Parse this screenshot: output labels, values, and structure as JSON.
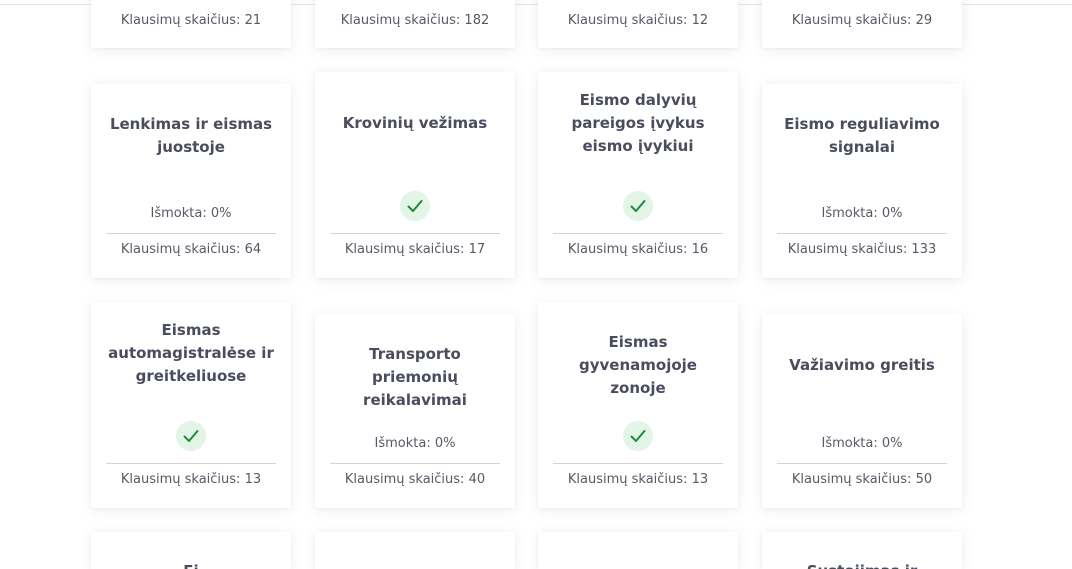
{
  "count_prefix": "Klausimų skaičius: ",
  "progress_prefix": "Išmokta: ",
  "top_row": [
    {
      "count": "Klausimų skaičius: 21"
    },
    {
      "count": "Klausimų skaičius: 182"
    },
    {
      "count": "Klausimų skaičius: 12"
    },
    {
      "count": "Klausimų skaičius: 29"
    }
  ],
  "row1": [
    {
      "title": "Lenkimas ir eismas juostoje",
      "progress": "Išmokta: 0%",
      "completed": false,
      "count": "Klausimų skaičius: 64"
    },
    {
      "title": "Krovinių vežimas",
      "progress": "",
      "completed": true,
      "count": "Klausimų skaičius: 17"
    },
    {
      "title": "Eismo dalyvių pareigos įvykus eismo įvykiui",
      "progress": "",
      "completed": true,
      "count": "Klausimų skaičius: 16"
    },
    {
      "title": "Eismo reguliavimo signalai",
      "progress": "Išmokta: 0%",
      "completed": false,
      "count": "Klausimų skaičius: 133"
    }
  ],
  "row2": [
    {
      "title": "Eismas automagistralėse ir greitkeliuose",
      "progress": "",
      "completed": true,
      "count": "Klausimų skaičius: 13"
    },
    {
      "title": "Transporto priemonių reikalavimai",
      "progress": "Išmokta: 0%",
      "completed": false,
      "count": "Klausimų skaičius: 40"
    },
    {
      "title": "Eismas gyvenamojoje zonoje",
      "progress": "",
      "completed": true,
      "count": "Klausimų skaičius: 13"
    },
    {
      "title": "Važiavimo greitis",
      "progress": "Išmokta: 0%",
      "completed": false,
      "count": "Klausimų skaičius: 50"
    }
  ],
  "bottom_row_partial": [
    {
      "title_fragment": "Ei"
    },
    {
      "title_fragment": ""
    },
    {
      "title_fragment": ""
    },
    {
      "title_fragment": "Sustojimas ir"
    }
  ],
  "colors": {
    "check_bg": "#e2f5e6",
    "check_stroke": "#1f8a3d",
    "title": "#4a4d5e",
    "text": "#555a66"
  },
  "icons": {
    "completed": "checkmark-icon"
  }
}
